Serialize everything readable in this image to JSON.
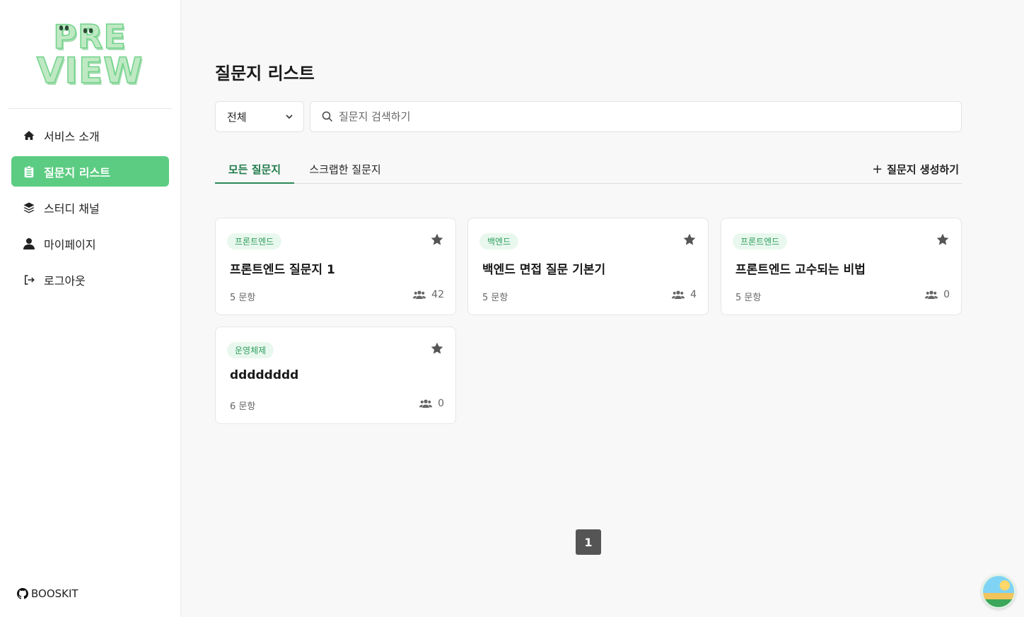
{
  "sidebar": {
    "logo": {
      "line1": "PRE",
      "line2": "VIEW"
    },
    "items": [
      {
        "label": "서비스 소개",
        "icon": "home-icon"
      },
      {
        "label": "질문지 리스트",
        "icon": "clipboard-icon",
        "active": true
      },
      {
        "label": "스터디 채널",
        "icon": "layers-icon"
      },
      {
        "label": "마이페이지",
        "icon": "user-icon"
      },
      {
        "label": "로그아웃",
        "icon": "logout-icon"
      }
    ],
    "github_label": "BOOSKIT"
  },
  "main": {
    "title": "질문지 리스트",
    "filter": {
      "selected": "전체"
    },
    "search": {
      "placeholder": "질문지 검색하기",
      "value": ""
    },
    "tabs": [
      {
        "label": "모든 질문지",
        "active": true
      },
      {
        "label": "스크랩한 질문지",
        "active": false
      }
    ],
    "create_label": "질문지 생성하기",
    "cards": [
      {
        "category": "프론트엔드",
        "title": "프론트엔드 질문지 1",
        "count": "5 문항",
        "users": "42"
      },
      {
        "category": "백엔드",
        "title": "백엔드 면접 질문 기본기",
        "count": "5 문항",
        "users": "4"
      },
      {
        "category": "프론트엔드",
        "title": "프론트엔드 고수되는 비법",
        "count": "5 문항",
        "users": "0"
      },
      {
        "category": "운영체제",
        "title": "dddddddd",
        "count": "6 문항",
        "users": "0"
      }
    ],
    "pagination": {
      "current": "1"
    }
  },
  "colors": {
    "accent": "#5ccc82",
    "tab_active": "#2a8a57",
    "badge_bg": "#e9f8ee",
    "badge_text": "#2f9e5e",
    "page_button": "#555555"
  }
}
